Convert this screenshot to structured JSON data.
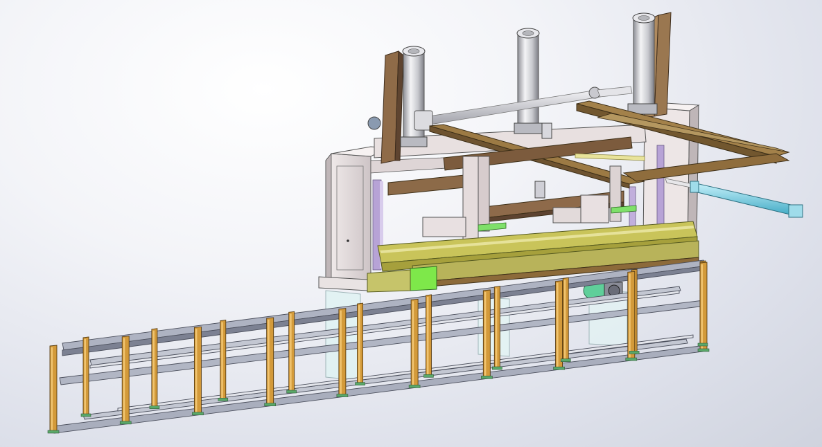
{
  "scene": {
    "type": "cad-3d-model-view",
    "subject": "machine-assembly",
    "colors": {
      "background_light": "#ffffff",
      "background_dark": "#d4d7e2",
      "base_frame_legs": "#d39a3a",
      "base_frame_rails": "#a9afbf",
      "press_frame": "#ece4e4",
      "brown_beams": "#8f6b48",
      "gantry_beams": "#9c7a44",
      "cylinders": "#d8d8dc",
      "yellow_conveyor": "#c9c45a",
      "green_block": "#7ee84a",
      "cyan_cylinder": "#7fd6ea",
      "lavender_columns": "#b7a3d6"
    }
  }
}
